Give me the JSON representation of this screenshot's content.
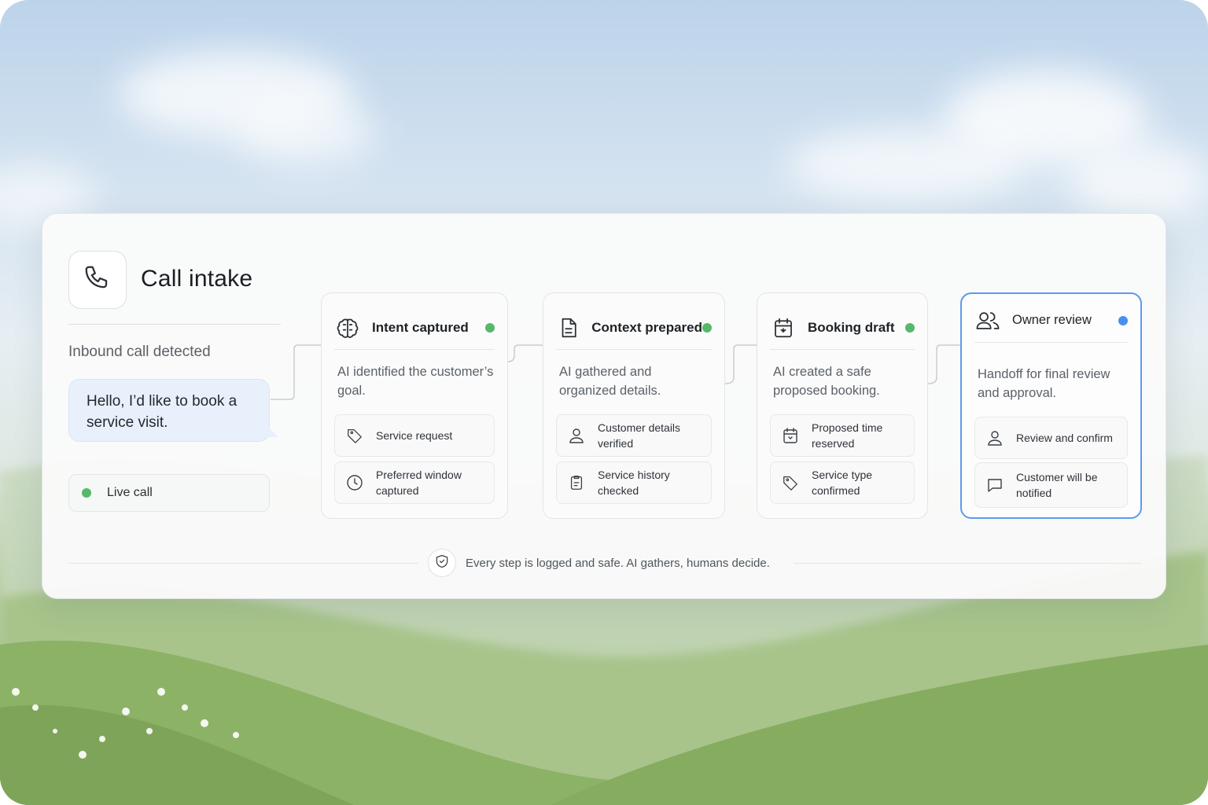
{
  "intake": {
    "title": "Call intake",
    "status": "Inbound call detected",
    "message": "Hello, I’d like to book a service visit.",
    "live_label": "Live call",
    "live_color": "#56b86b"
  },
  "steps": [
    {
      "title": "Intent captured",
      "icon": "brain-icon",
      "status_color": "#56b86b",
      "description": "AI identified the customer’s goal.",
      "items": [
        {
          "icon": "tag-icon",
          "label": "Service request"
        },
        {
          "icon": "clock-icon",
          "label": "Preferred window captured"
        }
      ]
    },
    {
      "title": "Context prepared",
      "icon": "document-icon",
      "status_color": "#56b86b",
      "description": "AI gathered and organized details.",
      "items": [
        {
          "icon": "user-icon",
          "label": "Customer details verified"
        },
        {
          "icon": "clipboard-icon",
          "label": "Service history checked"
        }
      ]
    },
    {
      "title": "Booking draft",
      "icon": "calendar-icon",
      "status_color": "#56b86b",
      "description": "AI created a safe proposed booking.",
      "items": [
        {
          "icon": "calendar-icon",
          "label": "Proposed time reserved"
        },
        {
          "icon": "tag-icon",
          "label": "Service type confirmed"
        }
      ]
    },
    {
      "title": "Owner review",
      "icon": "users-icon",
      "status_color": "#4a8ff0",
      "description": "Handoff for final review and approval.",
      "items": [
        {
          "icon": "user-icon",
          "label": "Review and confirm"
        },
        {
          "icon": "chat-icon",
          "label": "Customer will be notified"
        }
      ]
    }
  ],
  "footer": {
    "icon": "shield-icon",
    "text": "Every step is logged and safe. AI gathers, humans decide."
  }
}
